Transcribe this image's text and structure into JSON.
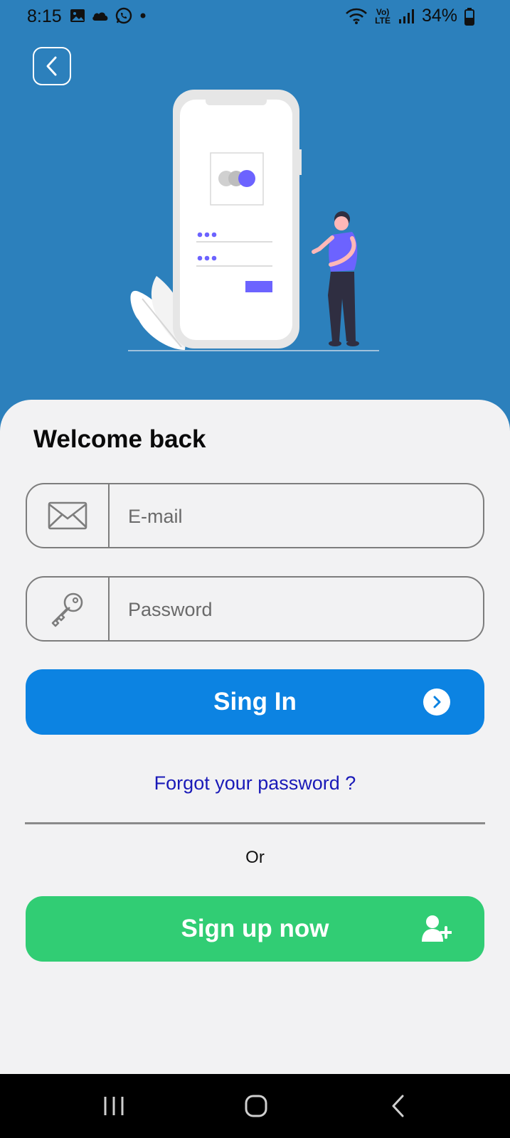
{
  "status_bar": {
    "time": "8:15",
    "battery_percent": "34%",
    "network_label": "LTE"
  },
  "header": {
    "back_icon": "chevron-left-icon"
  },
  "card": {
    "title": "Welcome back"
  },
  "form": {
    "email_placeholder": "E-mail",
    "password_placeholder": "Password",
    "email_icon": "envelope-icon",
    "password_icon": "key-icon"
  },
  "actions": {
    "signin_label": "Sing In",
    "forgot_label": "Forgot your password ?",
    "or_label": "Or",
    "signup_label": "Sign up now"
  },
  "colors": {
    "hero_bg": "#2c80bc",
    "signin_bg": "#0c83e2",
    "signup_bg": "#31cd74",
    "link": "#1a1ab8",
    "card_bg": "#f2f2f3"
  }
}
